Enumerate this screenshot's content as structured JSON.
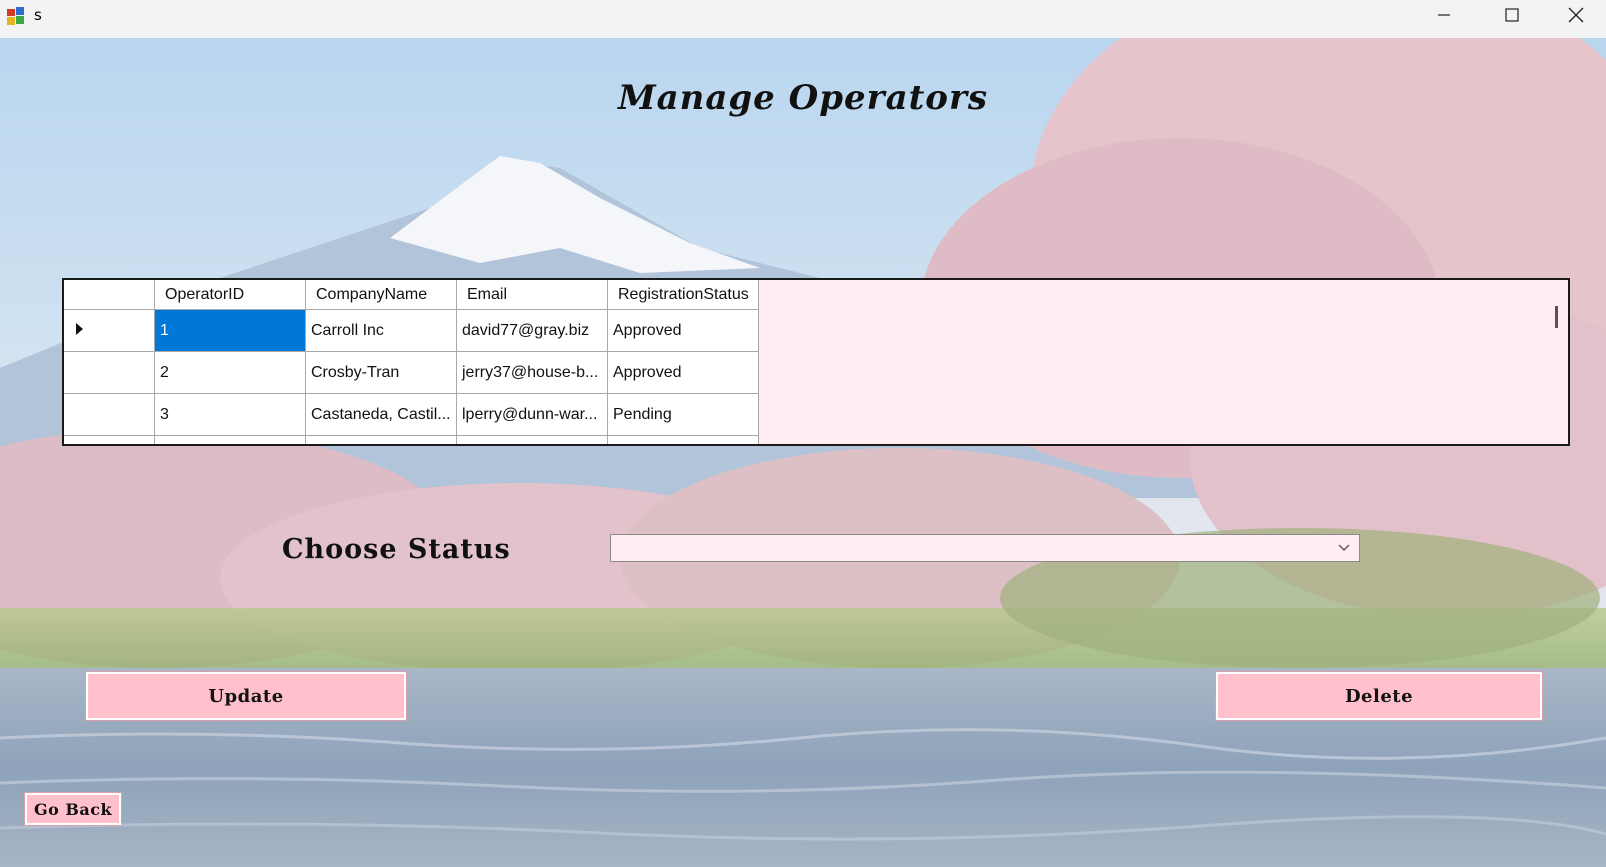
{
  "window": {
    "title": "s"
  },
  "page": {
    "title": "Manage Operators"
  },
  "grid": {
    "columns": [
      "OperatorID",
      "CompanyName",
      "Email",
      "RegistrationStatus"
    ],
    "rows": [
      {
        "OperatorID": "1",
        "CompanyName": "Carroll Inc",
        "Email": "david77@gray.biz",
        "RegistrationStatus": "Approved"
      },
      {
        "OperatorID": "2",
        "CompanyName": "Crosby-Tran",
        "Email": "jerry37@house-b...",
        "RegistrationStatus": "Approved"
      },
      {
        "OperatorID": "3",
        "CompanyName": "Castaneda, Castil...",
        "Email": "lperry@dunn-war...",
        "RegistrationStatus": "Pending"
      }
    ],
    "selected_row": 0
  },
  "form": {
    "status_label": "Choose Status",
    "status_value": ""
  },
  "buttons": {
    "update": "Update",
    "delete": "Delete",
    "back": "Go Back"
  },
  "colors": {
    "button_bg": "#ffc0cb",
    "grid_bg": "#ffedf2",
    "selection": "#0078d7"
  }
}
